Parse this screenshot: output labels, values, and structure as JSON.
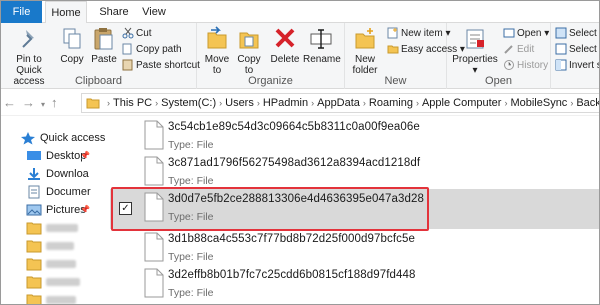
{
  "ribbon_tabs": [
    "File",
    "Home",
    "Share",
    "View"
  ],
  "clipboard": {
    "pin_label": "Pin to Quick access",
    "copy_label": "Copy",
    "paste_label": "Paste",
    "cut_label": "Cut",
    "copy_path_label": "Copy path",
    "paste_shortcut_label": "Paste shortcut",
    "group_label": "Clipboard"
  },
  "organize": {
    "move_to_label": "Move to",
    "copy_to_label": "Copy to",
    "delete_label": "Delete",
    "rename_label": "Rename",
    "group_label": "Organize"
  },
  "new": {
    "new_folder_label": "New folder",
    "new_item_label": "New item",
    "easy_access_label": "Easy access",
    "group_label": "New"
  },
  "open": {
    "properties_label": "Properties",
    "open_label": "Open",
    "edit_label": "Edit",
    "history_label": "History",
    "group_label": "Open"
  },
  "select": {
    "select_all_label": "Select all",
    "select_none_label": "Select no",
    "invert_label": "Invert sel"
  },
  "address": {
    "crumbs": [
      "This PC",
      "System(C:)",
      "Users",
      "HPadmin",
      "AppData",
      "Roaming",
      "Apple Computer",
      "MobileSync",
      "Backup"
    ]
  },
  "navpane": {
    "quick_access": "Quick access",
    "items": [
      "Desktop",
      "Downloa",
      "Documer",
      "Pictures"
    ]
  },
  "files": [
    {
      "name": "3c54cb1e89c54d3c09664c5b8311c0a00f9ea06e",
      "type": "Type: File"
    },
    {
      "name": "3c871ad1796f56275498ad3612a8394acd1218df",
      "type": "Type: File"
    },
    {
      "name": "3d0d7e5fb2ce288813306e4d4636395e047a3d28",
      "type": "Type: File"
    },
    {
      "name": "3d1b88ca4c553c7f77bd8b72d25f000d97bcfc5e",
      "type": "Type: File"
    },
    {
      "name": "3d2effb8b01b7fc7c25cdd6b0815cf188d97fd448",
      "type": "Type: File"
    }
  ],
  "colors": {
    "file_tab": "#1979ca",
    "highlight": "#e3333b",
    "selected_row": "#d9d9d9"
  }
}
